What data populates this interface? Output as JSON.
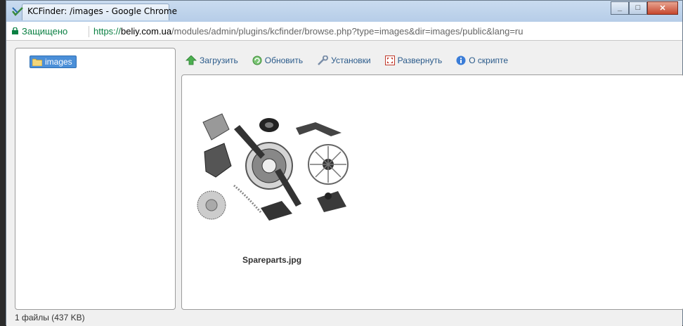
{
  "window": {
    "title": "KCFinder: /images - Google Chrome"
  },
  "address_bar": {
    "secure_label": "Защищено",
    "url_scheme": "https://",
    "url_host": "beliy.com.ua",
    "url_path": "/modules/admin/plugins/kcfinder/browse.php?type=images&dir=images/public&lang=ru"
  },
  "sidebar": {
    "folders": [
      {
        "label": "images",
        "icon": "folder-icon",
        "selected": true
      }
    ]
  },
  "toolbar": {
    "items": [
      {
        "label": "Загрузить",
        "icon": "upload-arrow-icon"
      },
      {
        "label": "Обновить",
        "icon": "refresh-icon"
      },
      {
        "label": "Установки",
        "icon": "wrench-icon"
      },
      {
        "label": "Развернуть",
        "icon": "maximize-icon"
      },
      {
        "label": "О скрипте",
        "icon": "info-icon"
      }
    ]
  },
  "files": [
    {
      "name": "Spareparts.jpg"
    }
  ],
  "status": {
    "text": "1 файлы (437 KB)"
  },
  "colors": {
    "accent": "#4b8fd8",
    "secure": "#0b8043",
    "toolbar_text": "#2a5a8a"
  }
}
